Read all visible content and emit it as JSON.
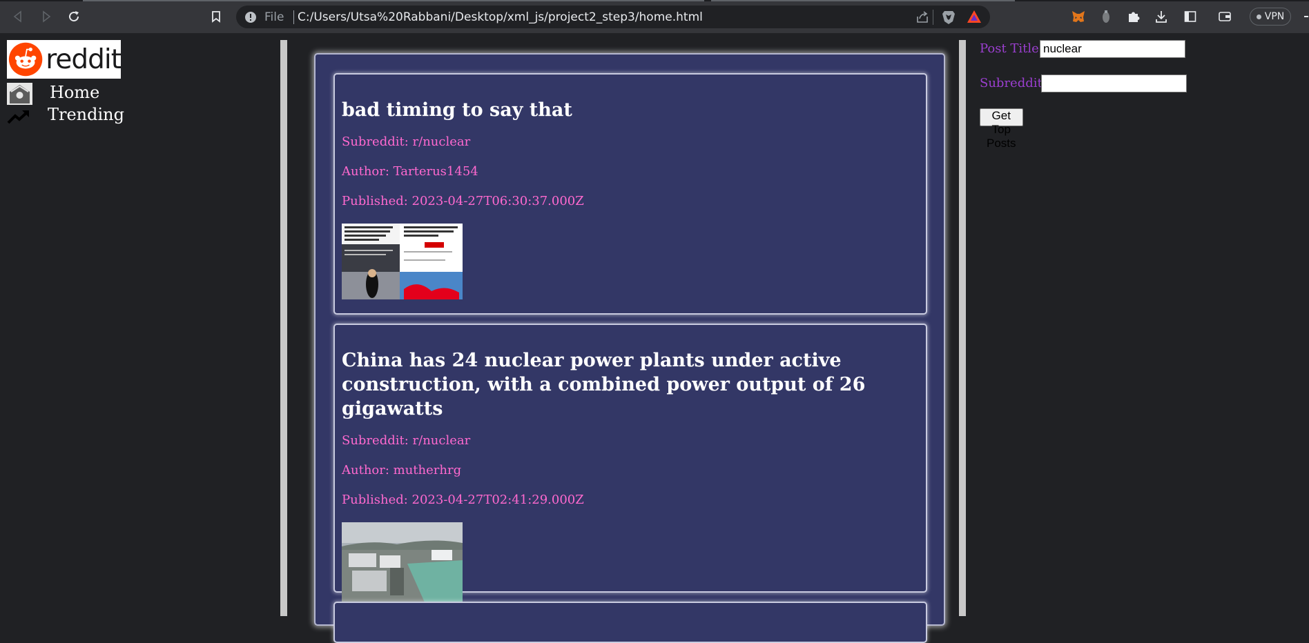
{
  "browser": {
    "scheme_label": "File",
    "url": "C:/Users/Utsa%20Rabbani/Desktop/xml_js/project2_step3/home.html",
    "vpn_label": "VPN"
  },
  "sidebar": {
    "logo_text": "reddit",
    "items": [
      {
        "label": "Home",
        "icon": "home-icon"
      },
      {
        "label": "Trending",
        "icon": "trending-icon"
      }
    ]
  },
  "posts": [
    {
      "title": "bad timing to say that",
      "subreddit": "Subreddit: r/nuclear",
      "author": "Author: Tarterus1454",
      "published": "Published: 2023-04-27T06:30:37.000Z",
      "thumb": "meme-thumbnail"
    },
    {
      "title": "China has 24 nuclear power plants under active construction, with a combined power output of 26 gigawatts",
      "subreddit": "Subreddit: r/nuclear",
      "author": "Author: mutherhrg",
      "published": "Published: 2023-04-27T02:41:29.000Z",
      "thumb": "power-plant-thumbnail"
    }
  ],
  "form": {
    "title_label": "Post Title:",
    "title_value": "nuclear",
    "subreddit_label": "Subreddit:",
    "subreddit_value": "",
    "submit_label": "Get Top Posts"
  },
  "colors": {
    "page_bg": "#202124",
    "feed_bg": "#333766",
    "meta_text": "#ff69cf",
    "form_label": "#9b3fd0"
  }
}
